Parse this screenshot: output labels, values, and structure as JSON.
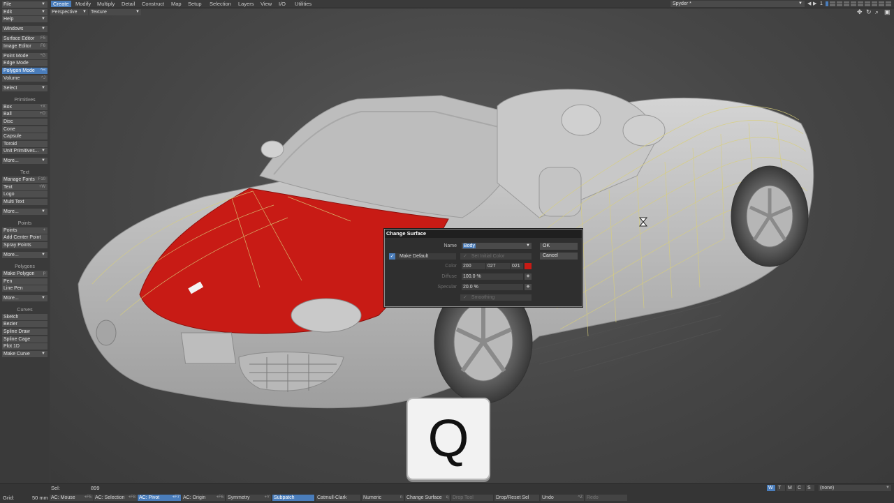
{
  "menu": {
    "tabs": [
      "Create",
      "Modify",
      "Multiply",
      "Detail",
      "Construct",
      "Map",
      "Setup",
      "Selection",
      "Layers",
      "View",
      "I/O",
      "Utilities"
    ],
    "active_tab": "Create",
    "object_name": "Spyder *",
    "layer_number": "1"
  },
  "sidebar": {
    "file": "File",
    "edit": "Edit",
    "help": "Help",
    "windows": "Windows",
    "surface_editor": "Surface Editor",
    "surface_editor_sc": "F5",
    "image_editor": "Image Editor",
    "image_editor_sc": "F6",
    "point_mode": "Point Mode",
    "point_mode_sc": "^G",
    "edge_mode": "Edge Mode",
    "polygon_mode": "Polygon Mode",
    "polygon_mode_sc": "^H",
    "volume": "Volume",
    "volume_sc": "^J",
    "select": "Select",
    "primitives_header": "Primitives",
    "box": "Box",
    "box_sc": "+X",
    "ball": "Ball",
    "ball_sc": "+O",
    "disc": "Disc",
    "cone": "Cone",
    "capsule": "Capsule",
    "toroid": "Toroid",
    "unit_primitives": "Unit Primitives...",
    "more1": "More...",
    "text_header": "Text",
    "manage_fonts": "Manage Fonts",
    "manage_fonts_sc": "F10",
    "text": "Text",
    "text_sc": "+W",
    "logo": "Logo",
    "multi_text": "Multi Text",
    "more2": "More...",
    "points_header": "Points",
    "points": "Points",
    "add_center_point": "Add Center Point",
    "spray_points": "Spray Points",
    "more3": "More...",
    "polygons_header": "Polygons",
    "make_polygon": "Make Polygon",
    "make_polygon_sc": "p",
    "pen": "Pen",
    "line_pen": "Line Pen",
    "more4": "More...",
    "curves_header": "Curves",
    "sketch": "Sketch",
    "bezier": "Bezier",
    "spline_draw": "Spline Draw",
    "spline_cage": "Spline Cage",
    "plot_1d": "Plot 1D",
    "make_curve": "Make Curve"
  },
  "viewport": {
    "view": "Perspective",
    "shading": "Texture"
  },
  "dialog": {
    "title": "Change Surface",
    "name_label": "Name",
    "name_value": "Body",
    "ok": "OK",
    "cancel": "Cancel",
    "make_default": "Make Default",
    "set_initial_color": "Set Initial Color",
    "color_label": "Color",
    "color_r": "200",
    "color_g": "027",
    "color_b": "021",
    "diffuse_label": "Diffuse",
    "diffuse_value": "100.0 %",
    "specular_label": "Specular",
    "specular_value": "20.0 %",
    "smoothing": "Smoothing",
    "swatch_color": "#c81b15"
  },
  "key_overlay": "Q",
  "bottom": {
    "sel_label": "Sel:",
    "sel_value": "899",
    "grid_label": "Grid:",
    "grid_value": "50 mm",
    "ac_mouse": "AC: Mouse",
    "ac_mouse_sc": "+F5",
    "ac_selection": "AC: Selection",
    "ac_selection_sc": "+F8",
    "ac_pivot": "AC: Pivot",
    "ac_pivot_sc": "+F7",
    "ac_origin": "AC: Origin",
    "ac_origin_sc": "+F6",
    "symmetry": "Symmetry",
    "symmetry_sc": "+Y",
    "subpatch": "Subpatch",
    "catmull_clark": "Catmull-Clark",
    "numeric": "Numeric",
    "numeric_sc": "n",
    "change_surface": "Change Surface",
    "change_surface_sc": "q",
    "drop_tool": "Drop Tool",
    "drop_reset_sel": "Drop/Reset Sel",
    "undo": "Undo",
    "undo_sc": "^Z",
    "redo": "Redo",
    "w": "W",
    "t": "T",
    "m": "M",
    "c": "C",
    "s": "S",
    "none": "(none)"
  },
  "colors": {
    "accent": "#4a7dbb",
    "hood": "#c81b15",
    "wire": "#d9cf7a"
  }
}
